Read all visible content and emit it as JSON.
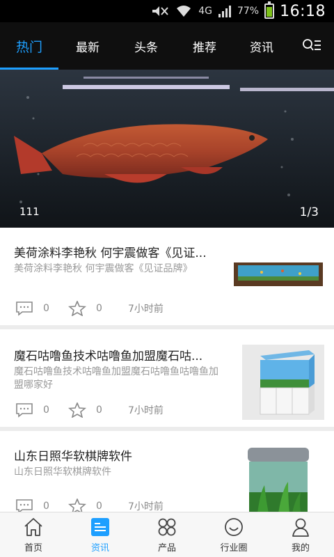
{
  "status_bar": {
    "network": "4G",
    "battery": "77%",
    "battery_level": 0.77,
    "time": "16:18"
  },
  "top_tabs": [
    {
      "label": "热门",
      "active": true
    },
    {
      "label": "最新",
      "active": false
    },
    {
      "label": "头条",
      "active": false
    },
    {
      "label": "推荐",
      "active": false
    },
    {
      "label": "资讯",
      "active": false
    }
  ],
  "top_menu_icon": "list-search-icon",
  "banner": {
    "caption": "111",
    "counter": "1/3"
  },
  "news": [
    {
      "title": "美荷涂料李艳秋 何宇震做客《见证...",
      "summary": "美荷涂料李艳秋 何宇震做客《见证品牌》",
      "comments": "0",
      "likes": "0",
      "time": "7小时前"
    },
    {
      "title": "魔石咕噜鱼技术咕噜鱼加盟魔石咕...",
      "summary": "魔石咕噜鱼技术咕噜鱼加盟魔石咕噜鱼咕噜鱼加盟哪家好",
      "comments": "0",
      "likes": "0",
      "time": "7小时前"
    },
    {
      "title": "山东日照华软棋牌软件",
      "summary": "山东日照华软棋牌软件",
      "comments": "0",
      "likes": "0",
      "time": "7小时前"
    }
  ],
  "bottom_nav": [
    {
      "label": "首页",
      "icon": "home-icon",
      "active": false
    },
    {
      "label": "资讯",
      "icon": "news-icon",
      "active": true
    },
    {
      "label": "产品",
      "icon": "products-icon",
      "active": false
    },
    {
      "label": "行业圈",
      "icon": "smile-icon",
      "active": false
    },
    {
      "label": "我的",
      "icon": "user-icon",
      "active": false
    }
  ],
  "colors": {
    "accent": "#1e9fff",
    "topbar": "#0f0f0f",
    "divider": "#ececec"
  }
}
